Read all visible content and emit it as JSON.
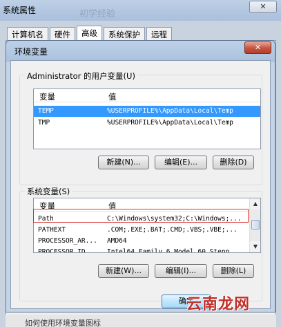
{
  "back_window": {
    "title": "系统属性",
    "ghost_title": "初学经验",
    "close_glyph": "✕",
    "tabs": [
      "计算机名",
      "硬件",
      "高级",
      "系统保护",
      "远程"
    ],
    "active_tab": "高级",
    "bottom_text": "如何使用环境变量图标"
  },
  "dialog": {
    "title": "环境变量",
    "close_glyph": "✕",
    "user_vars": {
      "group_label": "Administrator 的用户变量(U)",
      "columns": [
        "变量",
        "值"
      ],
      "rows": [
        {
          "name": "TEMP",
          "value": "%USERPROFILE%\\AppData\\Local\\Temp",
          "selected": true
        },
        {
          "name": "TMP",
          "value": "%USERPROFILE%\\AppData\\Local\\Temp",
          "selected": false
        }
      ],
      "buttons": {
        "new": "新建(N)...",
        "edit": "编辑(E)...",
        "delete": "删除(D)"
      }
    },
    "system_vars": {
      "group_label": "系统变量(S)",
      "columns": [
        "变量",
        "值"
      ],
      "rows": [
        {
          "name": "Path",
          "value": "C:\\Windows\\system32;C:\\Windows;...",
          "selected": false
        },
        {
          "name": "PATHEXT",
          "value": ".COM;.EXE;.BAT;.CMD;.VBS;.VBE;...",
          "selected": false
        },
        {
          "name": "PROCESSOR_AR...",
          "value": "AMD64",
          "selected": false
        },
        {
          "name": "PROCESSOR_ID...",
          "value": "Intel64 Family 6 Model 60 Stepp...",
          "selected": false
        }
      ],
      "buttons": {
        "new": "新建(W)...",
        "edit": "编辑(I)...",
        "delete": "删除(L)"
      },
      "scroll_up_glyph": "▲",
      "scroll_down_glyph": "▼"
    },
    "ok_button": "确定"
  },
  "watermark": {
    "text": "云南龙网"
  },
  "colors": {
    "selection": "#3399ff",
    "highlight_box": "#d9302c",
    "watermark": "#c0302a"
  }
}
